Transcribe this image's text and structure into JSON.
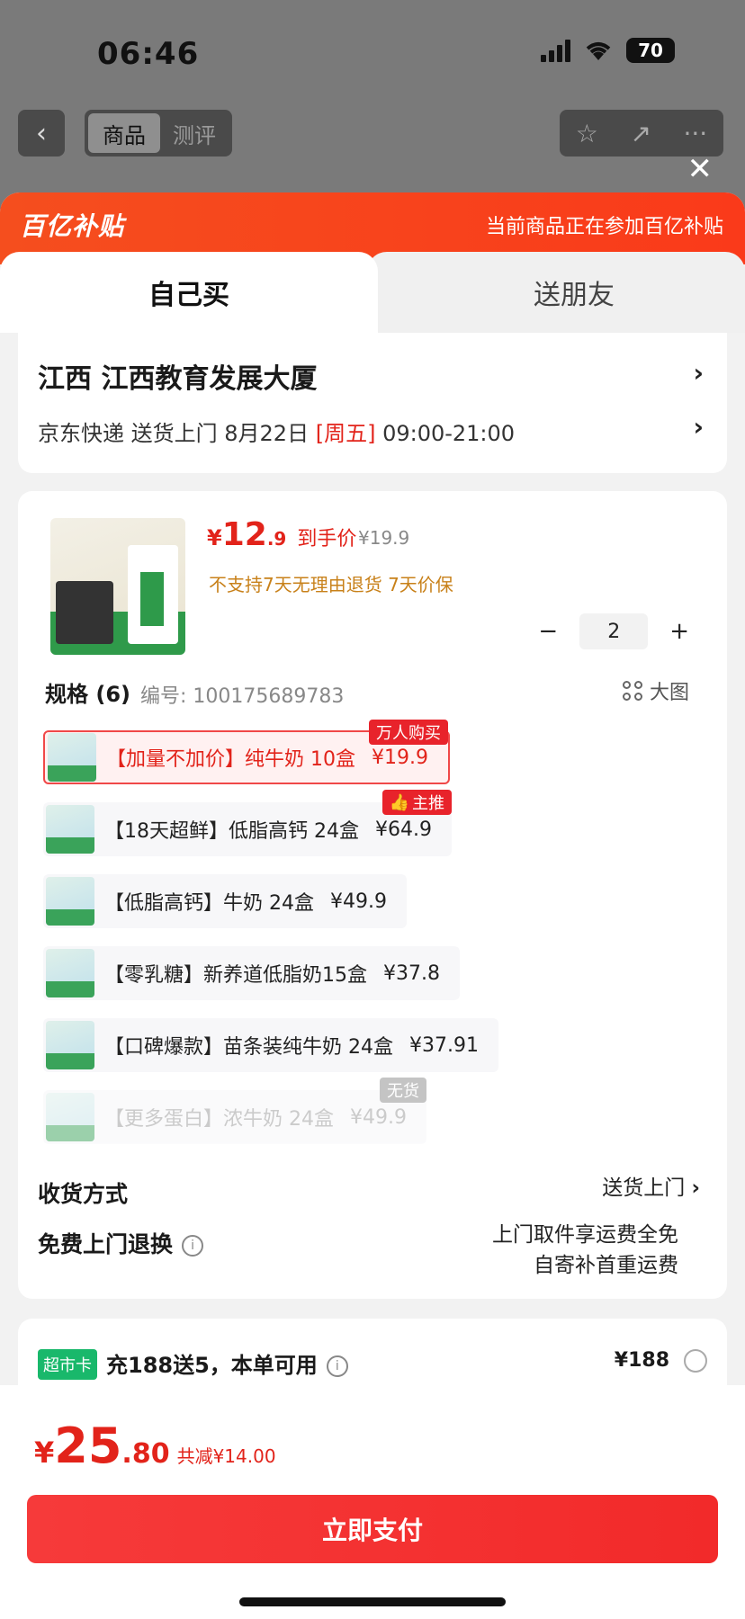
{
  "status_bar": {
    "time": "06:46",
    "battery": "70"
  },
  "nav": {
    "tab_active": "商品",
    "tab_inactive": "测评"
  },
  "banner": {
    "logo": "百亿补贴",
    "text": "当前商品正在参加百亿补贴"
  },
  "tabs": {
    "self": "自己买",
    "friend": "送朋友"
  },
  "address": {
    "line1": "江西  江西教育发展大厦",
    "delivery_prefix": "京东快递 送货上门 8月22日 ",
    "weekday": "[周五]",
    "delivery_time": " 09:00-21:00"
  },
  "product": {
    "price_yen": "¥",
    "price_int": "12",
    "price_dec": ".9",
    "price_label": "到手价",
    "original_price": "¥19.9",
    "policy": "不支持7天无理由退货  7天价保",
    "quantity": "2",
    "minus": "−",
    "plus": "+"
  },
  "specs": {
    "title": "规格 (6)",
    "number": "编号: 100175689783",
    "big_pic": "大图",
    "items": [
      {
        "label": "【加量不加价】纯牛奶 10盒",
        "price": "¥19.9",
        "tag": "万人购买",
        "state": "selected"
      },
      {
        "label": "【18天超鲜】低脂高钙 24盒",
        "price": "¥64.9",
        "tag": "主推",
        "state": "normal"
      },
      {
        "label": "【低脂高钙】牛奶 24盒",
        "price": "¥49.9",
        "tag": "",
        "state": "normal"
      },
      {
        "label": "【零乳糖】新养道低脂奶15盒",
        "price": "¥37.8",
        "tag": "",
        "state": "normal"
      },
      {
        "label": "【口碑爆款】苗条装纯牛奶 24盒",
        "price": "¥37.91",
        "tag": "",
        "state": "normal"
      },
      {
        "label": "【更多蛋白】浓牛奶 24盒",
        "price": "¥49.9",
        "tag": "无货",
        "state": "disabled"
      }
    ]
  },
  "receive": {
    "label": "收货方式",
    "value": "送货上门"
  },
  "return": {
    "label": "免费上门退换",
    "value_line1": "上门取件享运费全免",
    "value_line2": "自寄补首重运费"
  },
  "vip": {
    "badge": "超市卡",
    "text": "充188送5，本单可用",
    "price": "¥188"
  },
  "footer": {
    "total_yen": "¥",
    "total_int": "25",
    "total_dec": ".80",
    "saving": "共减¥14.00",
    "pay_button": "立即支付"
  }
}
